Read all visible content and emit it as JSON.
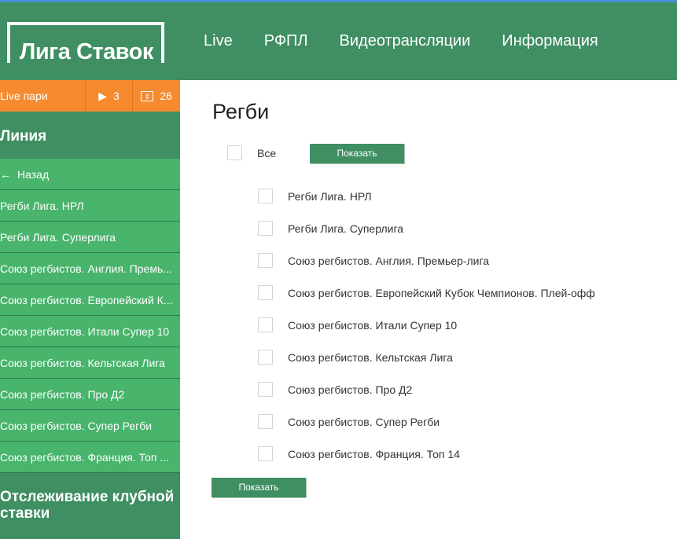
{
  "brand": {
    "logo_text": "Лига Ставок"
  },
  "nav": [
    "Live",
    "РФПЛ",
    "Видеотрансляции",
    "Информация"
  ],
  "sidebar": {
    "live": {
      "label": "Live пари",
      "play_count": "3",
      "tv_count": "26"
    },
    "line_title": "Линия",
    "back_label": "Назад",
    "items": [
      "Регби Лига. НРЛ",
      "Регби Лига. Суперлига",
      "Союз регбистов. Англия. Премь...",
      "Союз регбистов. Европейский К...",
      "Союз регбистов. Итали Супер 10",
      "Союз регбистов. Кельтская Лига",
      "Союз регбистов. Про Д2",
      "Союз регбистов. Супер Регби",
      "Союз регбистов. Франция. Топ ..."
    ],
    "tracking_title": "Отслеживание клубной ставки"
  },
  "main": {
    "title": "Регби",
    "all_label": "Все",
    "show_button": "Показать",
    "leagues": [
      "Регби Лига. НРЛ",
      "Регби Лига. Суперлига",
      "Союз регбистов. Англия. Премьер-лига",
      "Союз регбистов. Европейский Кубок Чемпионов. Плей-офф",
      "Союз регбистов. Итали Супер 10",
      "Союз регбистов. Кельтская Лига",
      "Союз регбистов. Про Д2",
      "Союз регбистов. Супер Регби",
      "Союз регбистов. Франция. Топ 14"
    ],
    "show_button_bottom": "Показать"
  },
  "colors": {
    "header": "#3f8f63",
    "sidebar_item": "#48b46c",
    "live_orange": "#f58a2f",
    "button": "#3f8f63"
  }
}
